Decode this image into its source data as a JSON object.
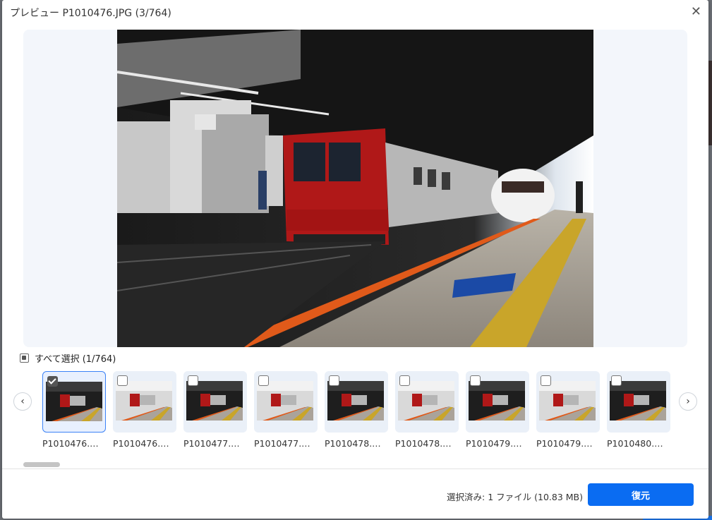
{
  "dialog": {
    "title": "プレビュー P1010476.JPG (3/764)",
    "close_icon": "close-icon"
  },
  "preview": {
    "image_icon": "train-station-photo"
  },
  "selection": {
    "select_all_label": "すべて選択 (1/764)"
  },
  "thumbnails": [
    {
      "label": "P1010476.…",
      "checked": true
    },
    {
      "label": "P1010476.…",
      "checked": false
    },
    {
      "label": "P1010477.…",
      "checked": false
    },
    {
      "label": "P1010477.…",
      "checked": false
    },
    {
      "label": "P1010478.…",
      "checked": false
    },
    {
      "label": "P1010478.…",
      "checked": false
    },
    {
      "label": "P1010479.…",
      "checked": false
    },
    {
      "label": "P1010479.…",
      "checked": false
    },
    {
      "label": "P1010480.…",
      "checked": false
    }
  ],
  "nav": {
    "prev_icon": "chevron-left-icon",
    "next_icon": "chevron-right-icon"
  },
  "footer": {
    "status": "選択済み: 1 ファイル (10.83 MB)",
    "restore_label": "復元"
  },
  "colors": {
    "accent": "#0a6cf2",
    "preview_bg": "#f3f6fb"
  }
}
